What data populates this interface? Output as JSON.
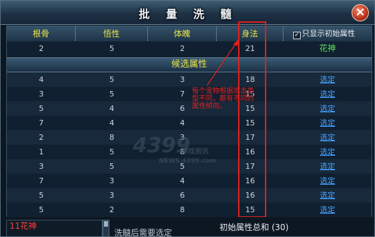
{
  "window": {
    "title": "批 量 洗 髓",
    "close_icon": "close-icon"
  },
  "header": {
    "columns": [
      "根骨",
      "悟性",
      "体魄",
      "身法"
    ],
    "checkbox_label": "只显示初始属性",
    "checkbox_checked": true
  },
  "current": {
    "values": [
      "2",
      "5",
      "2",
      "21"
    ],
    "label": "花神"
  },
  "section_label": "候选属性",
  "candidates": [
    {
      "values": [
        "4",
        "5",
        "3",
        "18"
      ],
      "action": "选定"
    },
    {
      "values": [
        "3",
        "5",
        "7",
        "15"
      ],
      "action": "选定"
    },
    {
      "values": [
        "5",
        "4",
        "6",
        "15"
      ],
      "action": "选定"
    },
    {
      "values": [
        "7",
        "4",
        "4",
        "15"
      ],
      "action": "选定"
    },
    {
      "values": [
        "2",
        "8",
        "3",
        "17"
      ],
      "action": "选定"
    },
    {
      "values": [
        "1",
        "5",
        "8",
        "16"
      ],
      "action": "选定"
    },
    {
      "values": [
        "3",
        "5",
        "5",
        "17"
      ],
      "action": "选定"
    },
    {
      "values": [
        "7",
        "3",
        "4",
        "16"
      ],
      "action": "选定"
    },
    {
      "values": [
        "5",
        "3",
        "6",
        "16"
      ],
      "action": "选定"
    },
    {
      "values": [
        "5",
        "2",
        "8",
        "15"
      ],
      "action": "选定"
    }
  ],
  "annotation": "每个宠物根据攻击类型不同，都有不同的属性倾向。",
  "watermark": {
    "main": "4399",
    "sub": "游戏资讯",
    "url": "NEWS.4399.com"
  },
  "bottom": {
    "pet_name": "11花神",
    "hint": "洗髓后需要选定",
    "total": "初始属性总和 (30)"
  },
  "colors": {
    "header_text": "#e7e44a",
    "link": "#4aa3ff",
    "annotation": "#e02020"
  }
}
